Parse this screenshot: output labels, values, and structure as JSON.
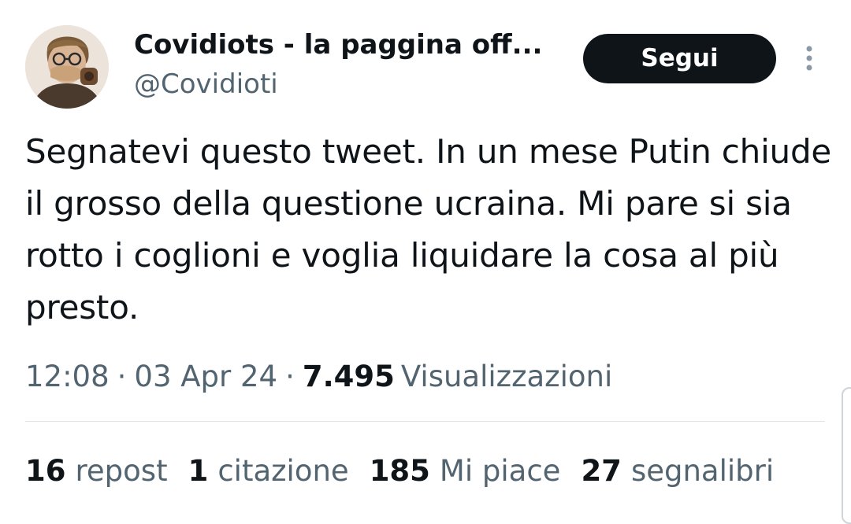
{
  "author": {
    "display_name": "Covidiots - la paggina off...",
    "handle": "@Covidioti",
    "avatar_icon": "person-with-gas-mask-avatar"
  },
  "follow_label": "Segui",
  "more_icon": "more-vertical-icon",
  "tweet": {
    "text": "Segnatevi questo tweet. In un mese Putin chiude il grosso della questione ucraina. Mi pare si sia rotto i coglioni e voglia liquidare la cosa al più presto."
  },
  "meta": {
    "time": "12:08",
    "separator": "·",
    "date": "03 Apr 24",
    "views_count": "7.495",
    "views_label": "Visualizzazioni"
  },
  "stats": {
    "reposts_count": "16",
    "reposts_label": "repost",
    "quotes_count": "1",
    "quotes_label": "citazione",
    "likes_count": "185",
    "likes_label": "Mi piace",
    "bookmarks_count": "27",
    "bookmarks_label": "segnalibri"
  },
  "colors": {
    "text_primary": "#0f1419",
    "text_secondary": "#536471",
    "button_bg": "#0f1419",
    "button_text": "#ffffff",
    "divider": "#dfe3e7"
  }
}
